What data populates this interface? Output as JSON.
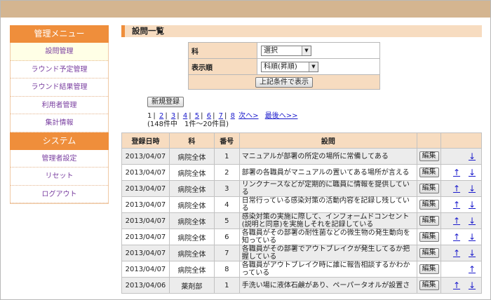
{
  "sidebar": {
    "menu_title": "管理メニュー",
    "menu_items": [
      "設問管理",
      "ラウンド予定管理",
      "ラウンド結果管理",
      "利用者管理",
      "集計情報"
    ],
    "system_title": "システム",
    "system_items": [
      "管理者設定",
      "リセット",
      "ログアウト"
    ]
  },
  "main": {
    "title": "設問一覧",
    "filter": {
      "dept_label": "科",
      "dept_value": "選択",
      "order_label": "表示順",
      "order_value": "科順(昇順)",
      "submit_label": "上記条件で表示"
    },
    "new_button": "新規登録",
    "pager": {
      "pages": [
        "1",
        "2",
        "3",
        "4",
        "5",
        "6",
        "7",
        "8"
      ],
      "next": "次へ>",
      "last": "最後へ>>",
      "count": "(148件中　1件～20件目)"
    },
    "table": {
      "headers": [
        "登録日時",
        "科",
        "番号",
        "設問",
        "",
        ""
      ],
      "edit_label": "編集",
      "up_arrow": "↑",
      "down_arrow": "↓",
      "rows": [
        {
          "date": "2013/04/07",
          "dept": "病院全体",
          "no": "1",
          "question": "マニュアルが部署の所定の場所に常備してある"
        },
        {
          "date": "2013/04/07",
          "dept": "病院全体",
          "no": "2",
          "question": "部署の各職員がマニュアルの置いてある場所が言える"
        },
        {
          "date": "2013/04/07",
          "dept": "病院全体",
          "no": "3",
          "question": "リンクナースなどが定期的に職員に情報を提供している"
        },
        {
          "date": "2013/04/07",
          "dept": "病院全体",
          "no": "4",
          "question": "日常行っている感染対策の活動内容を記録し残している"
        },
        {
          "date": "2013/04/07",
          "dept": "病院全体",
          "no": "5",
          "question": "感染対策の実施に際して、インフォームドコンセント(説明と同意)を実施しそれを記録している"
        },
        {
          "date": "2013/04/07",
          "dept": "病院全体",
          "no": "6",
          "question": "各職員がその部署の耐性菌などの微生物の発生動向を知っている"
        },
        {
          "date": "2013/04/07",
          "dept": "病院全体",
          "no": "7",
          "question": "各職員がその部署でアウトブレイクが発生してるか把握している"
        },
        {
          "date": "2013/04/07",
          "dept": "病院全体",
          "no": "8",
          "question": "各職員がアウトブレイク時に誰に報告相談するかわかっている"
        },
        {
          "date": "2013/04/06",
          "dept": "薬剤部",
          "no": "1",
          "question": "手洗い場に液体石鹸があり、ペーパータオルが設置さ"
        }
      ]
    }
  }
}
